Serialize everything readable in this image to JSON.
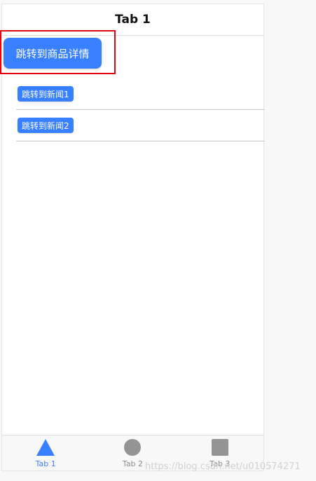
{
  "header": {
    "title": "Tab 1"
  },
  "content": {
    "primary_button_label": "跳转到商品详情",
    "list": [
      {
        "label": "跳转到新闻1"
      },
      {
        "label": "跳转到新闻2"
      }
    ]
  },
  "tabbar": {
    "tabs": [
      {
        "label": "Tab 1",
        "icon": "triangle-icon",
        "active": true
      },
      {
        "label": "Tab 2",
        "icon": "circle-icon",
        "active": false
      },
      {
        "label": "Tab 3",
        "icon": "square-icon",
        "active": false
      }
    ]
  },
  "watermark": "https://blog.csdn.net/u010574271",
  "colors": {
    "primary": "#3880ff",
    "inactive": "#8c8c8c",
    "highlight": "#e0040f"
  }
}
